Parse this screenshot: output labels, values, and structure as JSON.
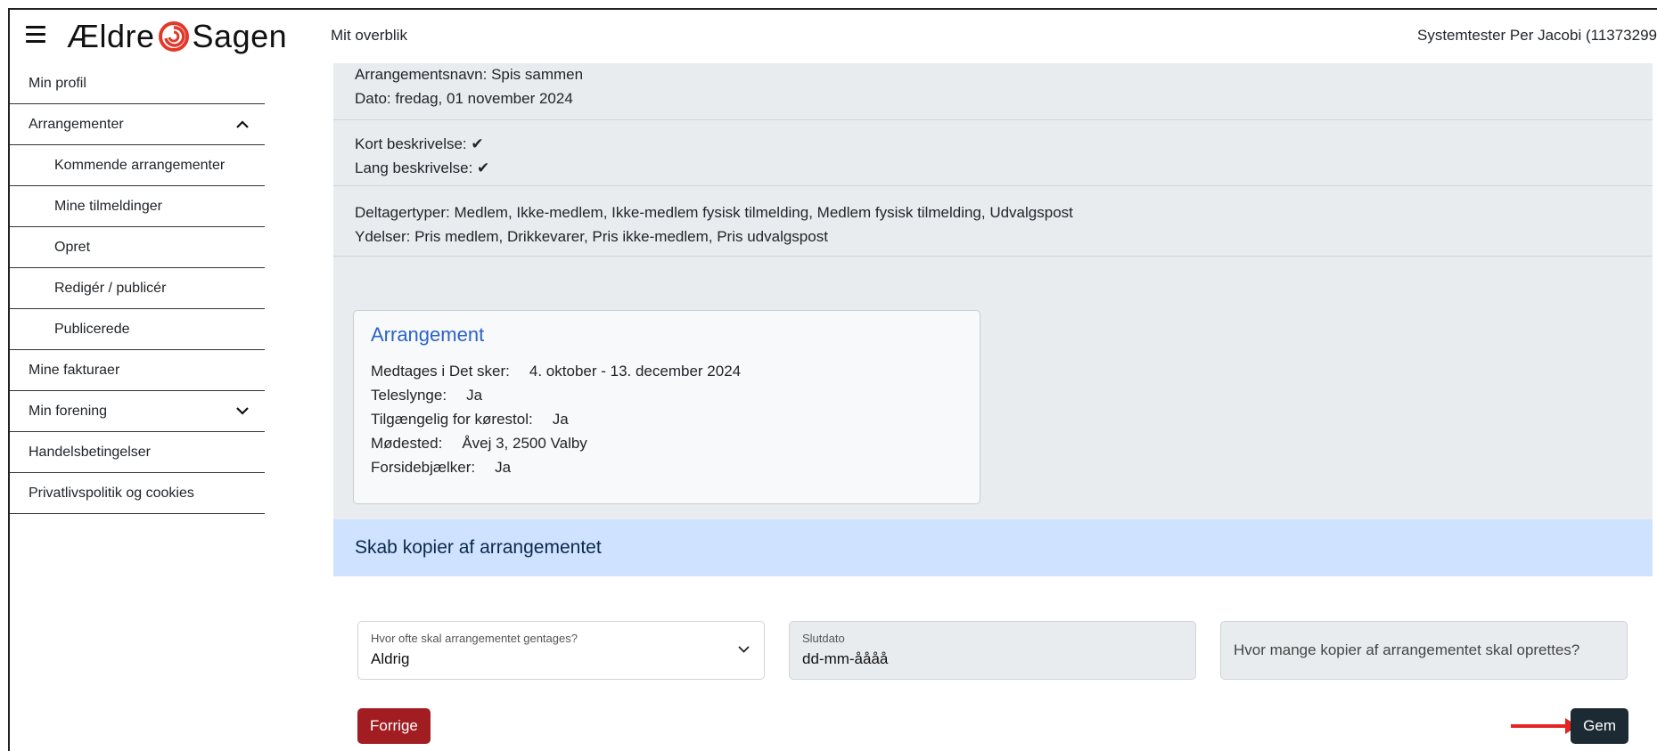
{
  "header": {
    "logo_part1": "Ældre",
    "logo_part2": "Sagen",
    "app_title": "Mit overblik",
    "user": "Systemtester Per Jacobi (11373299"
  },
  "sidebar": {
    "items": [
      {
        "label": "Min profil"
      },
      {
        "label": "Arrangementer",
        "chevron": "^"
      },
      {
        "label": "Kommende arrangementer"
      },
      {
        "label": "Mine tilmeldinger"
      },
      {
        "label": "Opret"
      },
      {
        "label": "Redigér / publicér"
      },
      {
        "label": "Publicerede"
      },
      {
        "label": "Mine fakturaer"
      },
      {
        "label": "Min forening",
        "chevron": "⌄"
      },
      {
        "label": "Handelsbetingelser"
      },
      {
        "label": "Privatlivspolitik og cookies"
      }
    ]
  },
  "summary": {
    "name_line": "Arrangementsnavn: Spis sammen",
    "date_line": "Dato: fredag, 01 november 2024",
    "short_desc": "Kort beskrivelse:",
    "long_desc": "Lang beskrivelse:",
    "check": "✔",
    "participant_types": "Deltagertyper: Medlem, Ikke-medlem, Ikke-medlem fysisk tilmelding, Medlem fysisk tilmelding, Udvalgspost",
    "services": "Ydelser: Pris medlem, Drikkevarer, Pris ikke-medlem, Pris udvalgspost"
  },
  "card": {
    "title": "Arrangement",
    "rows": [
      {
        "label": "Medtages i Det sker:",
        "value": "4. oktober - 13. december 2024"
      },
      {
        "label": "Teleslynge:",
        "value": "Ja"
      },
      {
        "label": "Tilgængelig for kørestol:",
        "value": "Ja"
      },
      {
        "label": "Mødested:",
        "value": "Åvej 3, 2500 Valby"
      },
      {
        "label": "Forsidebjælker:",
        "value": "Ja"
      }
    ]
  },
  "copies": {
    "header": "Skab kopier af arrangementet",
    "repeat_label": "Hvor ofte skal arrangementet gentages?",
    "repeat_value": "Aldrig",
    "end_label": "Slutdato",
    "end_value": "dd-mm-åååå",
    "count_placeholder": "Hvor mange kopier af arrangementet skal oprettes?",
    "prev_button": "Forrige",
    "save_button": "Gem"
  }
}
